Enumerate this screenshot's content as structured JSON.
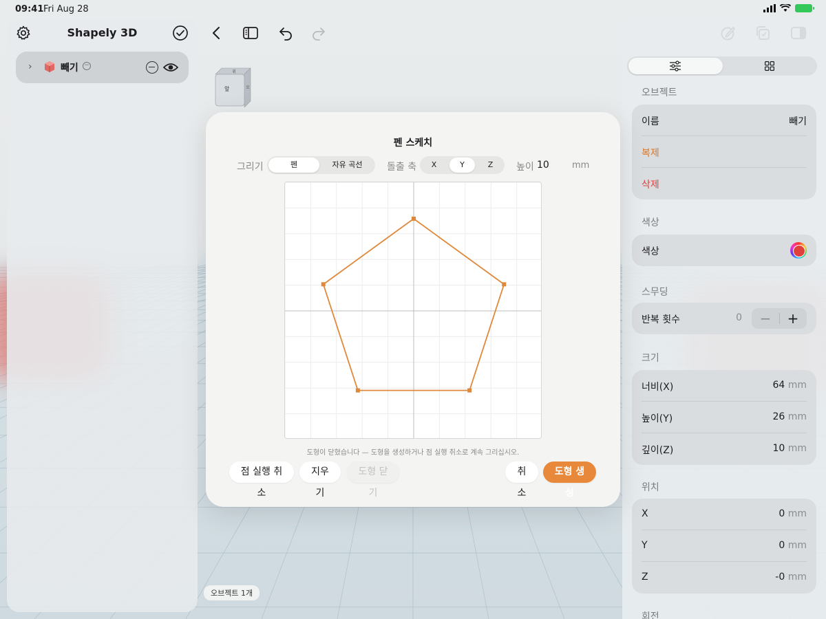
{
  "status_bar": {
    "time": "09:41",
    "date": "Fri Aug 28"
  },
  "sidebar": {
    "title": "Shapely 3D",
    "layer": {
      "name": "빼기"
    }
  },
  "viewport": {
    "view_cube_face": "앞",
    "object_count": "오브젝트 1개"
  },
  "inspector": {
    "object_section": "오브젝트",
    "name_label": "이름",
    "name_value": "빼기",
    "duplicate": "복제",
    "delete": "삭제",
    "color_section": "색상",
    "color_label": "색상",
    "smoothing_section": "스무딩",
    "iterations_label": "반복 횟수",
    "iterations_value": "0",
    "size_section": "크기",
    "width_label": "너비(X)",
    "width_value": "64",
    "height_label": "높이(Y)",
    "height_value": "26",
    "depth_label": "깊이(Z)",
    "depth_value": "10",
    "unit": "mm",
    "position_section": "위치",
    "pos_x_label": "X",
    "pos_x_value": "0",
    "pos_y_label": "Y",
    "pos_y_value": "0",
    "pos_z_label": "Z",
    "pos_z_value": "-0",
    "rotation_section": "회전"
  },
  "sketch_modal": {
    "title": "펜 스케치",
    "draw_label": "그리기",
    "draw_modes": [
      "펜",
      "자유 곡선"
    ],
    "draw_mode_selected": "펜",
    "axis_label": "돌출 축",
    "axes": [
      "X",
      "Y",
      "Z"
    ],
    "axis_selected": "Y",
    "height_label": "높이",
    "height_value": "10",
    "height_unit": "mm",
    "hint": "도형이 닫혔습니다 — 도형을 생성하거나 점 실행 취소로 계속 그리십시오.",
    "undo_point": "점 실행 취소",
    "clear": "지우기",
    "close_shape": "도형 닫기",
    "cancel": "취소",
    "create_shape": "도형 생성",
    "stroke_color": "#e0883a"
  },
  "colors": {
    "accent": "#e8883a",
    "destructive": "#e0403b",
    "duplicate": "#d8772a"
  }
}
